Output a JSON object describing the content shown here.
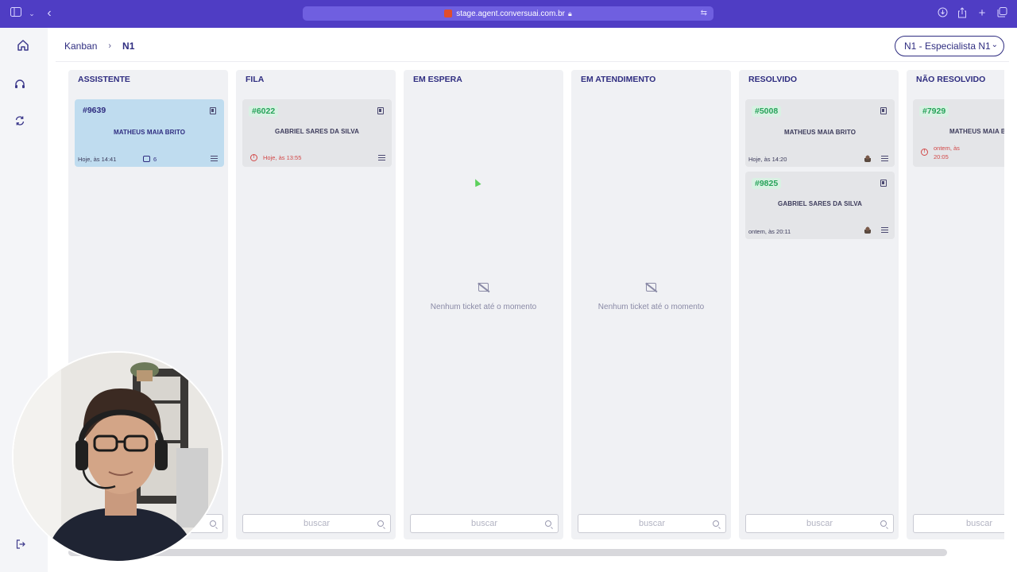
{
  "browser": {
    "url": "stage.agent.conversuai.com.br",
    "icons": [
      "sidebar-icon",
      "chevron-down-icon",
      "back-icon",
      "translate-icon",
      "download-icon",
      "share-icon",
      "plus-icon",
      "tabs-icon"
    ]
  },
  "sidebar": {
    "items": [
      {
        "icon": "home-icon"
      },
      {
        "icon": "headset-icon"
      },
      {
        "icon": "refresh-icon"
      }
    ],
    "bottom_icon": "logout-icon"
  },
  "header": {
    "breadcrumb_root": "Kanban",
    "breadcrumb_sep": "›",
    "breadcrumb_current": "N1",
    "queue_select": "N1 - Especialista N1"
  },
  "columns": [
    {
      "title": "ASSISTENTE",
      "search_placeholder": "buscar",
      "cards": [
        {
          "id": "#9639",
          "name": "MATHEUS MAIA BRITO",
          "time": "Hoje, às 14:41",
          "messages": "6"
        }
      ]
    },
    {
      "title": "FILA",
      "search_placeholder": "buscar",
      "cards": [
        {
          "id": "#6022",
          "name": "GABRIEL SARES DA SILVA",
          "time": "Hoje, às 13:55"
        }
      ]
    },
    {
      "title": "EM ESPERA",
      "search_placeholder": "buscar",
      "empty_text": "Nenhum ticket até o momento"
    },
    {
      "title": "EM ATENDIMENTO",
      "search_placeholder": "buscar",
      "empty_text": "Nenhum ticket até o momento"
    },
    {
      "title": "RESOLVIDO",
      "search_placeholder": "buscar",
      "cards": [
        {
          "id": "#5008",
          "name": "MATHEUS MAIA BRITO",
          "time": "Hoje, às 14:20"
        },
        {
          "id": "#9825",
          "name": "GABRIEL SARES DA SILVA",
          "time": "ontem, às 20:11"
        }
      ]
    },
    {
      "title": "NÃO RESOLVIDO",
      "search_placeholder": "buscar",
      "cards": [
        {
          "id": "#7929",
          "name": "MATHEUS MAIA BRITO",
          "time_line1": "ontem, às",
          "time_line2": "20:05"
        }
      ]
    }
  ],
  "colors": {
    "brand_purple": "#4f3dc4",
    "text_navy": "#2f2d80",
    "ticket_green": "#27a35a",
    "late_red": "#d24848",
    "active_card": "#bfdcef"
  }
}
